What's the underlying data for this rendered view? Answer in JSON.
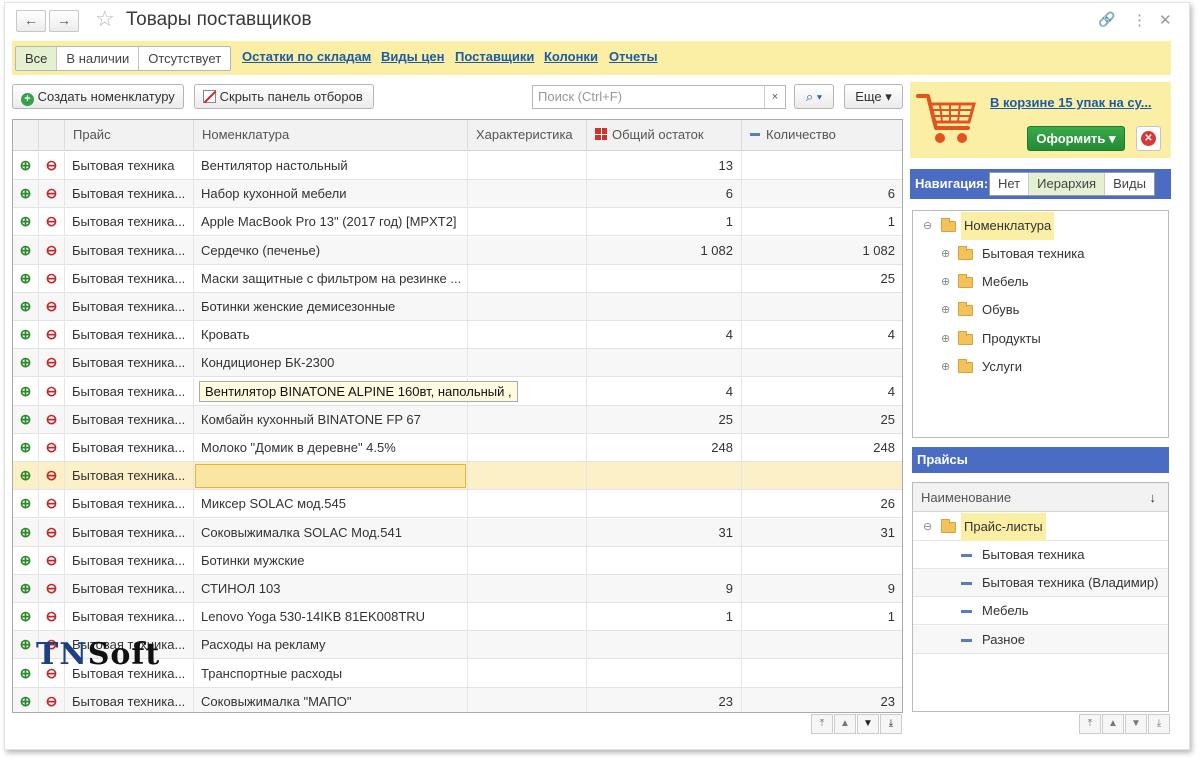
{
  "window": {
    "title": "Товары поставщиков",
    "back_icon": "arrow-left-icon",
    "forward_icon": "arrow-right-icon",
    "favorite_icon": "star-icon",
    "link_icon": "link-icon",
    "more_icon": "kebab-icon",
    "close_icon": "close-icon"
  },
  "filters": {
    "segments": [
      "Все",
      "В наличии",
      "Отсутствует"
    ],
    "active": "Все",
    "links": [
      "Остатки по складам",
      "Виды цен",
      "Поставщики",
      "Колонки",
      "Отчеты"
    ]
  },
  "toolbar": {
    "create_label": "Создать номенклатуру",
    "hide_filters_label": "Скрыть панель отборов",
    "search_placeholder": "Поиск (Ctrl+F)",
    "search_clear": "×",
    "search_btn": "⌕ ▾",
    "more_label": "Еще ▾"
  },
  "grid": {
    "columns": [
      "Прайс",
      "Номенклатура",
      "Характеристика",
      "Общий остаток",
      "Количество"
    ],
    "rows": [
      {
        "price": "Бытовая техника",
        "item": "Вентилятор настольный",
        "char": "",
        "stock": "13",
        "qty": ""
      },
      {
        "price": "Бытовая техника...",
        "item": "Набор кухонной мебели",
        "char": "",
        "stock": "6",
        "qty": "6"
      },
      {
        "price": "Бытовая техника...",
        "item": "Apple MacBook Pro 13\" (2017 год) [MPXT2]",
        "char": "",
        "stock": "1",
        "qty": "1"
      },
      {
        "price": "Бытовая техника...",
        "item": "Сердечко (печенье)",
        "char": "",
        "stock": "1 082",
        "qty": "1 082"
      },
      {
        "price": "Бытовая техника...",
        "item": "Маски защитные с фильтром на резинке ...",
        "char": "",
        "stock": "",
        "qty": "25"
      },
      {
        "price": "Бытовая техника...",
        "item": "Ботинки женские демисезонные",
        "char": "",
        "stock": "",
        "qty": ""
      },
      {
        "price": "Бытовая техника...",
        "item": "Кровать",
        "char": "",
        "stock": "4",
        "qty": "4"
      },
      {
        "price": "Бытовая техника...",
        "item": "Кондиционер БК-2300",
        "char": "",
        "stock": "",
        "qty": ""
      },
      {
        "price": "Бытовая техника...",
        "item": "Вентилятор BINATONE ALPINE 160вт, напольный ,",
        "char": "",
        "stock": "4",
        "qty": "4"
      },
      {
        "price": "Бытовая техника...",
        "item": "Комбайн кухонный BINATONE FP 67",
        "char": "",
        "stock": "25",
        "qty": "25"
      },
      {
        "price": "Бытовая техника...",
        "item": "Молоко \"Домик в деревне\" 4.5%",
        "char": "",
        "stock": "248",
        "qty": "248"
      },
      {
        "price": "Бытовая техника...",
        "item": "",
        "char": "",
        "stock": "",
        "qty": ""
      },
      {
        "price": "Бытовая техника...",
        "item": "Миксер SOLAC мод.545",
        "char": "",
        "stock": "",
        "qty": "26"
      },
      {
        "price": "Бытовая техника...",
        "item": "Соковыжималка  SOLAC  Мод.541",
        "char": "",
        "stock": "31",
        "qty": "31"
      },
      {
        "price": "Бытовая техника...",
        "item": "Ботинки мужские",
        "char": "",
        "stock": "",
        "qty": ""
      },
      {
        "price": "Бытовая техника...",
        "item": "СТИНОЛ 103",
        "char": "",
        "stock": "9",
        "qty": "9"
      },
      {
        "price": "Бытовая техника...",
        "item": "Lenovo Yoga 530-14IKB 81EK008TRU",
        "char": "",
        "stock": "1",
        "qty": "1"
      },
      {
        "price": "Бытовая техника...",
        "item": "Расходы на рекламу",
        "char": "",
        "stock": "",
        "qty": ""
      },
      {
        "price": "Бытовая техника...",
        "item": "Транспортные расходы",
        "char": "",
        "stock": "",
        "qty": ""
      },
      {
        "price": "Бытовая техника...",
        "item": "Соковыжималка \"МАПО\"",
        "char": "",
        "stock": "23",
        "qty": "23"
      }
    ],
    "selected_row": 11,
    "tooltip_row": 8,
    "row_icons": [
      "cart-add-icon",
      "cart-remove-icon"
    ],
    "pager": [
      "⤒",
      "▲",
      "▼",
      "⤓"
    ]
  },
  "cart": {
    "icon": "shopping-cart-icon",
    "link": "В корзине 15 упак на су...",
    "order_label": "Оформить ▾",
    "cancel_icon": "cancel-icon"
  },
  "navigation": {
    "label": "Навигация:",
    "modes": [
      "Нет",
      "Иерархия",
      "Виды"
    ],
    "active": "Иерархия",
    "tree": {
      "root": "Номенклатура",
      "children": [
        "Бытовая техника",
        "Мебель",
        "Обувь",
        "Продукты",
        "Услуги"
      ]
    }
  },
  "prices": {
    "title": "Прайсы",
    "column": "Наименование",
    "sort_icon": "↓",
    "root": "Прайс-листы",
    "items": [
      "Бытовая техника",
      "Бытовая техника (Владимир)",
      "Мебель",
      "Разное"
    ]
  },
  "logo": {
    "part1": "TN",
    "part2": "Soft"
  }
}
